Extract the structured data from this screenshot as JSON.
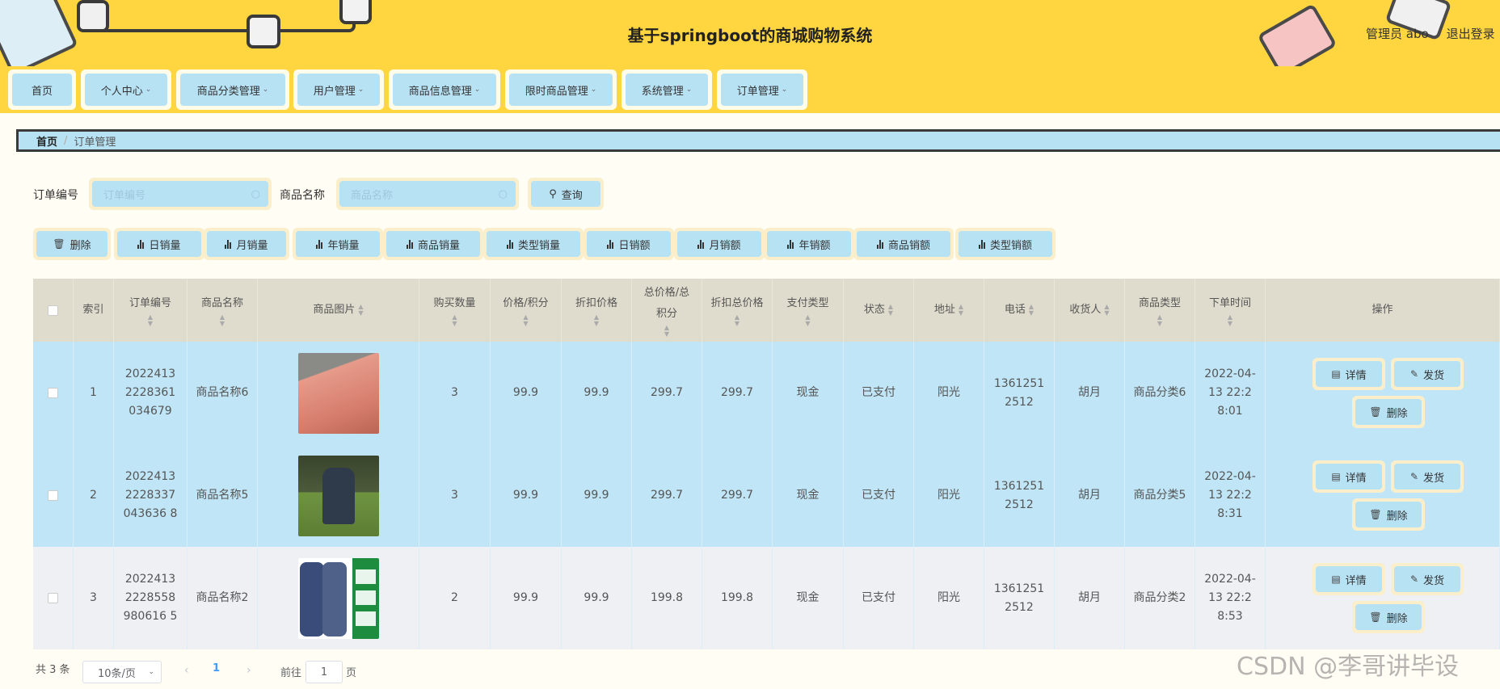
{
  "header": {
    "title": "基于springboot的商城购物系统",
    "user_label": "管理员 abo",
    "logout_label": "退出登录"
  },
  "nav": [
    {
      "label": "首页",
      "has_dropdown": false
    },
    {
      "label": "个人中心",
      "has_dropdown": true
    },
    {
      "label": "商品分类管理",
      "has_dropdown": true
    },
    {
      "label": "用户管理",
      "has_dropdown": true
    },
    {
      "label": "商品信息管理",
      "has_dropdown": true
    },
    {
      "label": "限时商品管理",
      "has_dropdown": true
    },
    {
      "label": "系统管理",
      "has_dropdown": true
    },
    {
      "label": "订单管理",
      "has_dropdown": true
    }
  ],
  "breadcrumb": {
    "home": "首页",
    "separator": "/",
    "current": "订单管理"
  },
  "search": {
    "order_no_label": "订单编号",
    "order_no_placeholder": "订单编号",
    "product_name_label": "商品名称",
    "product_name_placeholder": "商品名称",
    "query_label": "查询"
  },
  "actions": [
    "删除",
    "日销量",
    "月销量",
    "年销量",
    "商品销量",
    "类型销量",
    "日销额",
    "月销额",
    "年销额",
    "商品销额",
    "类型销额"
  ],
  "table": {
    "columns": [
      "",
      "索引",
      "订单编号",
      "商品名称",
      "商品图片",
      "购买数量",
      "价格/积分",
      "折扣价格",
      "总价格/总积分",
      "折扣总价格",
      "支付类型",
      "状态",
      "地址",
      "电话",
      "收货人",
      "商品类型",
      "下单时间",
      "操作"
    ],
    "rows": [
      {
        "index": "1",
        "order_no": "20224132228361034679",
        "product_name": "商品名称6",
        "image": "pink-blanket",
        "qty": "3",
        "price": "99.9",
        "discount_price": "99.9",
        "total": "299.7",
        "discount_total": "299.7",
        "pay_type": "现金",
        "status": "已支付",
        "address": "阳光",
        "phone": "13612512512",
        "receiver": "胡月",
        "category": "商品分类6",
        "order_time": "2022-04-13 22:28:01"
      },
      {
        "index": "2",
        "order_no": "20224132228337043636 8",
        "product_name": "商品名称5",
        "image": "sports-photo",
        "qty": "3",
        "price": "99.9",
        "discount_price": "99.9",
        "total": "299.7",
        "discount_total": "299.7",
        "pay_type": "现金",
        "status": "已支付",
        "address": "阳光",
        "phone": "13612512512",
        "receiver": "胡月",
        "category": "商品分类5",
        "order_time": "2022-04-13 22:28:31"
      },
      {
        "index": "3",
        "order_no": "20224132228558980616 5",
        "product_name": "商品名称2",
        "image": "camo-uniform",
        "qty": "2",
        "price": "99.9",
        "discount_price": "99.9",
        "total": "199.8",
        "discount_total": "199.8",
        "pay_type": "现金",
        "status": "已支付",
        "address": "阳光",
        "phone": "13612512512",
        "receiver": "胡月",
        "category": "商品分类2",
        "order_time": "2022-04-13 22:28:53"
      }
    ],
    "row_actions": {
      "detail": "详情",
      "ship": "发货",
      "delete": "删除"
    }
  },
  "pagination": {
    "total": "共 3 条",
    "page_size": "10条/页",
    "current_page": "1",
    "goto_label": "前往",
    "goto_value": "1",
    "page_unit": "页"
  },
  "watermark": "CSDN @李哥讲毕设"
}
